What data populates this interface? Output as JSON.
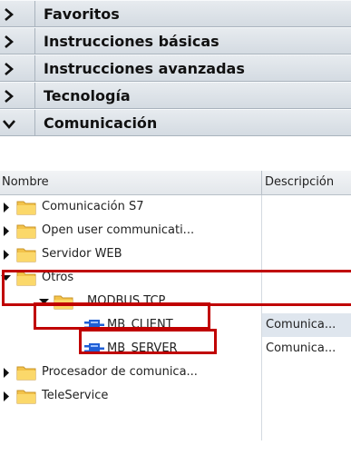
{
  "sections": [
    {
      "label": "Favoritos",
      "expanded": false
    },
    {
      "label": "Instrucciones básicas",
      "expanded": false
    },
    {
      "label": "Instrucciones avanzadas",
      "expanded": false
    },
    {
      "label": "Tecnología",
      "expanded": false
    },
    {
      "label": "Comunicación",
      "expanded": true
    }
  ],
  "columns": {
    "name": "Nombre",
    "description": "Descripción"
  },
  "tree": [
    {
      "label": "Comunicación S7",
      "icon": "folder-icon",
      "toggle": "collapsed",
      "desc": ""
    },
    {
      "label": "Open user communicati...",
      "icon": "folder-icon",
      "toggle": "collapsed",
      "desc": ""
    },
    {
      "label": "Servidor WEB",
      "icon": "folder-icon",
      "toggle": "collapsed",
      "desc": ""
    },
    {
      "label": "Otros",
      "icon": "folder-icon",
      "toggle": "expanded",
      "desc": ""
    },
    {
      "label": "MODBUS TCP",
      "icon": "folder-icon",
      "toggle": "expanded",
      "desc": ""
    },
    {
      "label": "MB_CLIENT",
      "icon": "function-block-icon",
      "toggle": "none",
      "desc": "Comunica..."
    },
    {
      "label": "MB_SERVER",
      "icon": "function-block-icon",
      "toggle": "none",
      "desc": "Comunica..."
    },
    {
      "label": "Procesador de comunica...",
      "icon": "folder-icon",
      "toggle": "collapsed",
      "desc": ""
    },
    {
      "label": "TeleService",
      "icon": "folder-icon",
      "toggle": "collapsed",
      "desc": ""
    }
  ],
  "highlight_color": "#c00000"
}
